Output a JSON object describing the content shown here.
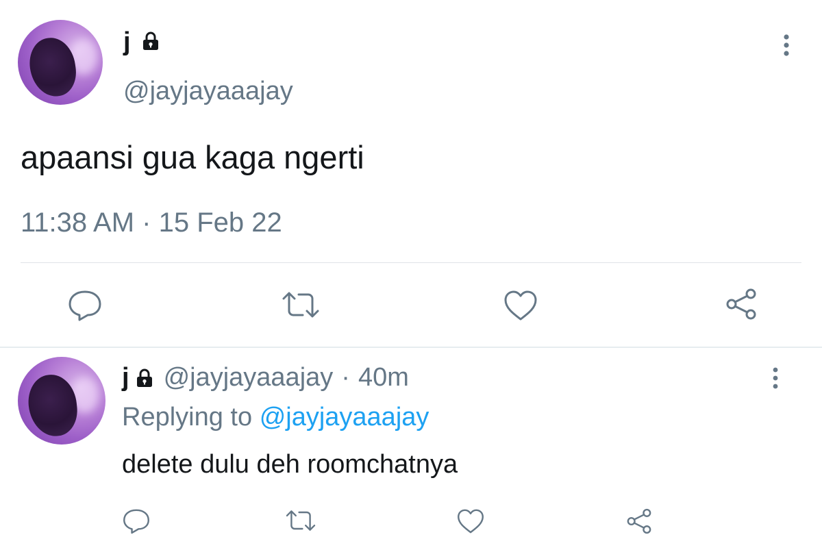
{
  "main_tweet": {
    "display_name": "j",
    "protected_icon": "lock-icon",
    "handle": "@jayjayaaajay",
    "text": "apaansi gua kaga ngerti",
    "timestamp": "11:38 AM · 15 Feb 22",
    "more_icon": "more-vertical-icon",
    "actions": [
      "reply-icon",
      "retweet-icon",
      "like-icon",
      "share-icon"
    ]
  },
  "reply_tweet": {
    "display_name": "j",
    "protected_icon": "lock-icon",
    "handle": "@jayjayaaajay",
    "separator": "·",
    "age": "40m",
    "replying_label": "Replying to",
    "replying_target": "@jayjayaaajay",
    "text": "delete dulu deh roomchatnya",
    "more_icon": "more-vertical-icon",
    "actions": [
      "reply-icon",
      "retweet-icon",
      "like-icon",
      "share-icon"
    ]
  },
  "colors": {
    "text_primary": "#14171a",
    "text_secondary": "#657786",
    "link": "#1da1f2",
    "divider": "#dfe3e7"
  }
}
